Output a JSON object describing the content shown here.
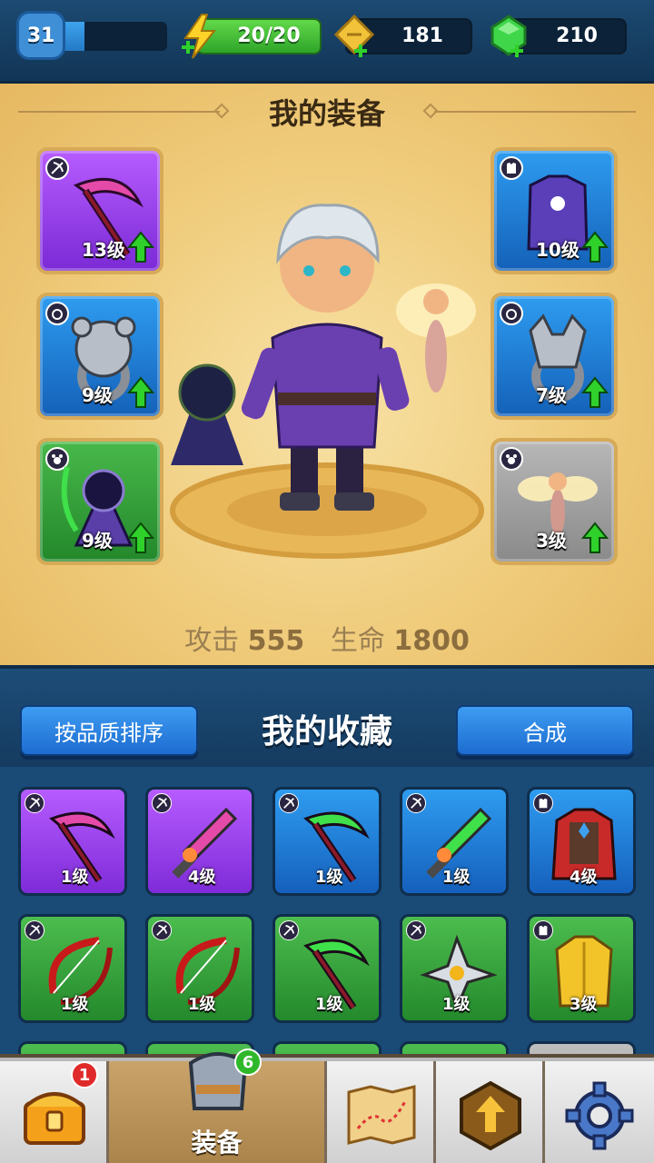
{
  "top_bar": {
    "level": "31",
    "xp_progress": 0.25,
    "energy": "20/20",
    "gold": "181",
    "gems": "210"
  },
  "equipment": {
    "title": "我的装备",
    "left_slots": [
      {
        "level": "13级",
        "rarity": "purple",
        "item": "scythe",
        "type": "weapon"
      },
      {
        "level": "9级",
        "rarity": "blue",
        "item": "bear-ring",
        "type": "ring"
      },
      {
        "level": "9级",
        "rarity": "green",
        "item": "reaper-pet",
        "type": "pet"
      }
    ],
    "right_slots": [
      {
        "level": "10级",
        "rarity": "blue",
        "item": "armor",
        "type": "armor"
      },
      {
        "level": "7级",
        "rarity": "blue",
        "item": "wolf-ring",
        "type": "ring"
      },
      {
        "level": "3级",
        "rarity": "gray",
        "item": "fairy-pet",
        "type": "pet"
      }
    ],
    "stats": {
      "attack_label": "攻击",
      "attack_value": "555",
      "hp_label": "生命",
      "hp_value": "1800"
    }
  },
  "collection": {
    "title": "我的收藏",
    "sort_button": "按品质排序",
    "merge_button": "合成",
    "items": [
      {
        "level": "1级",
        "rarity": "purple",
        "item": "scythe"
      },
      {
        "level": "4级",
        "rarity": "purple",
        "item": "sword"
      },
      {
        "level": "1级",
        "rarity": "blue",
        "item": "scythe"
      },
      {
        "level": "1级",
        "rarity": "blue",
        "item": "sword"
      },
      {
        "level": "4级",
        "rarity": "blue",
        "item": "cape-armor"
      },
      {
        "level": "1级",
        "rarity": "green",
        "item": "bow"
      },
      {
        "level": "1级",
        "rarity": "green",
        "item": "bow"
      },
      {
        "level": "1级",
        "rarity": "green",
        "item": "scythe"
      },
      {
        "level": "1级",
        "rarity": "green",
        "item": "shuriken"
      },
      {
        "level": "3级",
        "rarity": "green",
        "item": "gold-armor"
      }
    ]
  },
  "nav": {
    "chest_badge": "1",
    "equip_badge": "6",
    "equip_label": "装备"
  },
  "colors": {
    "purple": "#9a45ee",
    "blue": "#2582d8",
    "green": "#38a03c",
    "gray": "#a5a5a5"
  }
}
